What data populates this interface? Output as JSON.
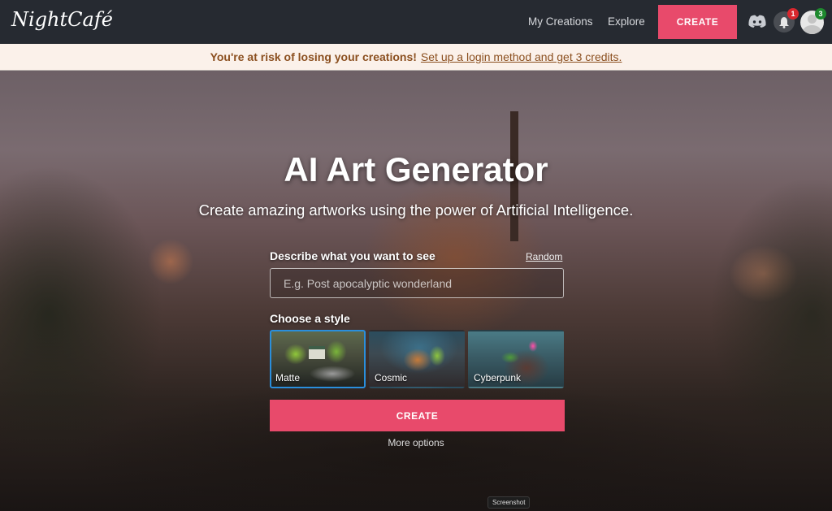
{
  "header": {
    "logo": "NightCafé",
    "nav": [
      {
        "label": "My Creations"
      },
      {
        "label": "Explore"
      }
    ],
    "create_label": "CREATE",
    "notifications_count": "1",
    "profile_badge_count": "3",
    "icons": {
      "discord": "discord-icon",
      "bell": "bell-icon",
      "avatar": "user-avatar"
    },
    "accent_color": "#e84a6b"
  },
  "banner": {
    "bold_text": "You're at risk of losing your creations!",
    "link_text": "Set up a login method and get 3 credits."
  },
  "hero": {
    "title": "AI Art Generator",
    "subtitle": "Create amazing artworks using the power of Artificial Intelligence.",
    "prompt_label": "Describe what you want to see",
    "random_label": "Random",
    "prompt_placeholder": "E.g. Post apocalyptic wonderland",
    "prompt_value": "",
    "style_label": "Choose a style",
    "styles": [
      {
        "name": "Matte",
        "selected": true
      },
      {
        "name": "Cosmic",
        "selected": false
      },
      {
        "name": "Cyberpunk",
        "selected": false
      }
    ],
    "create_label": "CREATE",
    "more_options_label": "More options"
  },
  "tooltip": {
    "text": "Screenshot"
  }
}
